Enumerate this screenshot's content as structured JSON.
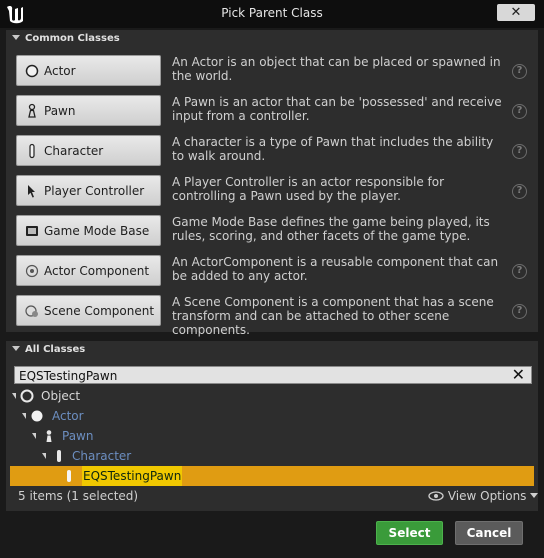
{
  "window": {
    "title": "Pick Parent Class",
    "close_label": "✕"
  },
  "common": {
    "header": "Common Classes",
    "items": [
      {
        "label": "Actor",
        "icon": "actor-sphere-icon",
        "desc": "An Actor is an object that can be placed or spawned in the world."
      },
      {
        "label": "Pawn",
        "icon": "pawn-icon",
        "desc": "A Pawn is an actor that can be 'possessed' and receive input from a controller."
      },
      {
        "label": "Character",
        "icon": "character-icon",
        "desc": "A character is a type of Pawn that includes the ability to walk around."
      },
      {
        "label": "Player Controller",
        "icon": "player-controller-icon",
        "desc": "A Player Controller is an actor responsible for controlling a Pawn used by the player."
      },
      {
        "label": "Game Mode Base",
        "icon": "game-mode-icon",
        "desc": "Game Mode Base defines the game being played, its rules, scoring, and other facets of the game type."
      },
      {
        "label": "Actor Component",
        "icon": "actor-component-icon",
        "desc": "An ActorComponent is a reusable component that can be added to any actor."
      },
      {
        "label": "Scene Component",
        "icon": "scene-component-icon",
        "desc": "A Scene Component is a component that has a scene transform and can be attached to other scene components."
      }
    ],
    "help": "?"
  },
  "all": {
    "header": "All Classes",
    "search_value": "EQSTestingPawn",
    "tree": [
      {
        "label": "Object",
        "expanded": true
      },
      {
        "label": "Actor",
        "expanded": true
      },
      {
        "label": "Pawn",
        "expanded": true
      },
      {
        "label": "Character",
        "expanded": true
      },
      {
        "label": "EQSTestingPawn",
        "selected": true
      }
    ],
    "status": "5 items (1 selected)",
    "view_options": "View Options"
  },
  "buttons": {
    "select": "Select",
    "cancel": "Cancel"
  },
  "colors": {
    "select_green": "#3a9b3a",
    "selection_orange": "#e09c12",
    "filter_highlight": "#f0c800"
  }
}
